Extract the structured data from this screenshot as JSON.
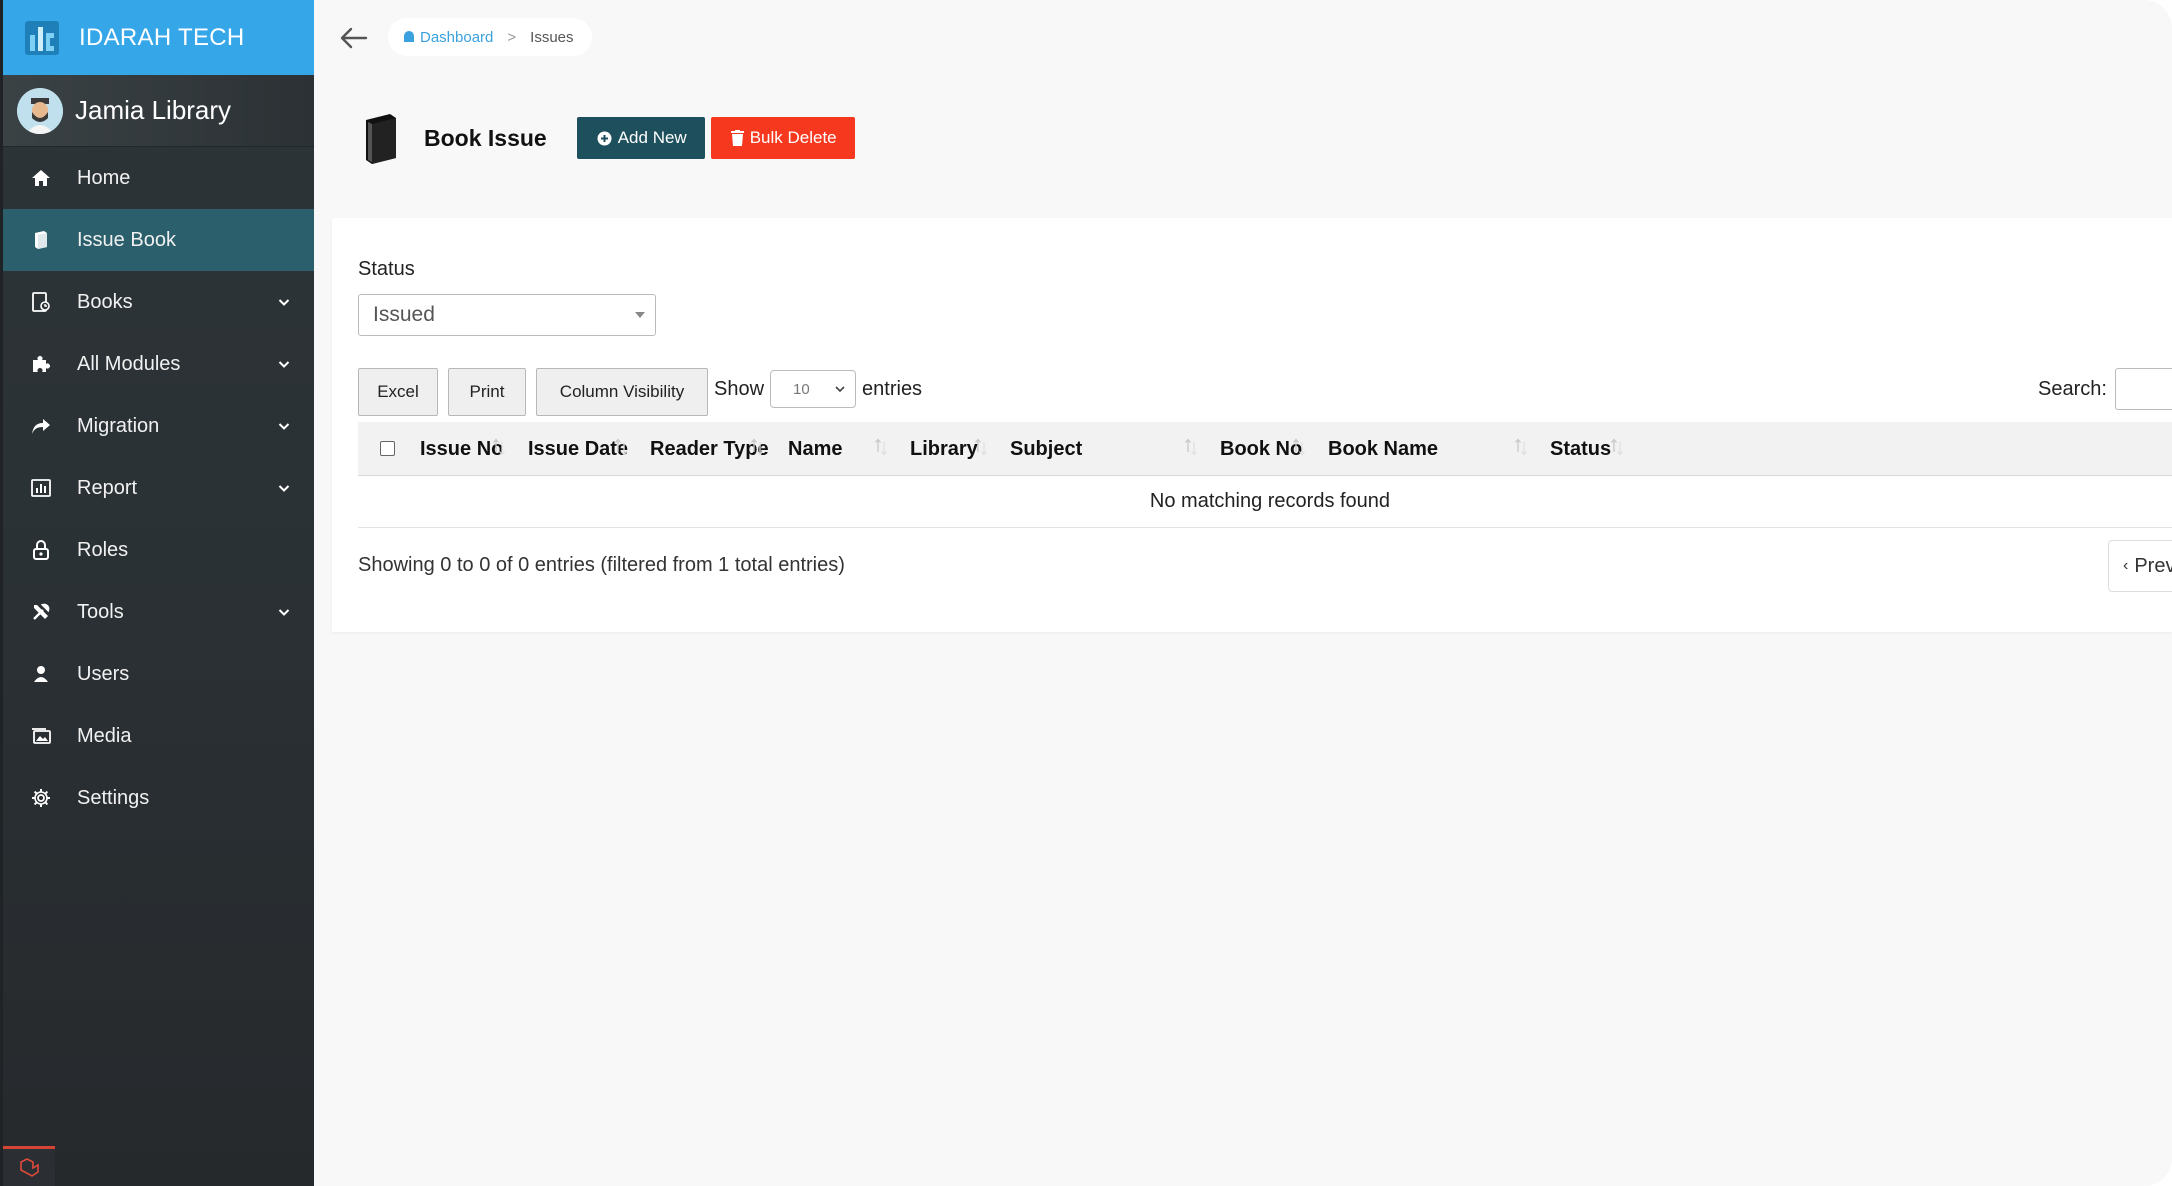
{
  "brand": {
    "name": "IDARAH TECH"
  },
  "user": {
    "name": "Jamia Library"
  },
  "sidebar": {
    "items": [
      {
        "label": "Home",
        "icon": "home-icon",
        "has_children": false,
        "active": false
      },
      {
        "label": "Issue Book",
        "icon": "book-open-icon",
        "has_children": false,
        "active": true
      },
      {
        "label": "Books",
        "icon": "books-icon",
        "has_children": true,
        "active": false
      },
      {
        "label": "All Modules",
        "icon": "puzzle-icon",
        "has_children": true,
        "active": false
      },
      {
        "label": "Migration",
        "icon": "share-arrow-icon",
        "has_children": true,
        "active": false
      },
      {
        "label": "Report",
        "icon": "chart-icon",
        "has_children": true,
        "active": false
      },
      {
        "label": "Roles",
        "icon": "lock-icon",
        "has_children": false,
        "active": false
      },
      {
        "label": "Tools",
        "icon": "tools-icon",
        "has_children": true,
        "active": false
      },
      {
        "label": "Users",
        "icon": "user-icon",
        "has_children": false,
        "active": false
      },
      {
        "label": "Media",
        "icon": "images-icon",
        "has_children": false,
        "active": false
      },
      {
        "label": "Settings",
        "icon": "gear-icon",
        "has_children": false,
        "active": false
      }
    ]
  },
  "breadcrumb": {
    "home": "Dashboard",
    "current": "Issues"
  },
  "page": {
    "title": "Book Issue",
    "add_new_label": "Add New",
    "bulk_delete_label": "Bulk Delete"
  },
  "filters": {
    "status_label": "Status",
    "status_value": "Issued"
  },
  "table_tools": {
    "excel_label": "Excel",
    "print_label": "Print",
    "column_visibility_label": "Column Visibility",
    "show_label": "Show",
    "entries_value": "10",
    "entries_label": "entries",
    "search_label": "Search:"
  },
  "table": {
    "columns": [
      "Issue No",
      "Issue Date",
      "Reader Type",
      "Name",
      "Library",
      "Subject",
      "Book No",
      "Book Name",
      "Status"
    ],
    "empty_message": "No matching records found",
    "info": "Showing 0 to 0 of 0 entries (filtered from 1 total entries)",
    "pager_prev": "Prev"
  },
  "colors": {
    "brand": "#35a6e8",
    "sidebar_active": "#2a5f6b",
    "add_button": "#1d4f5d",
    "delete_button": "#f5381e"
  }
}
